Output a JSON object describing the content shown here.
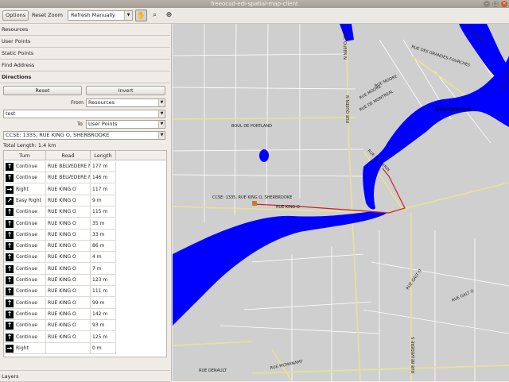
{
  "window": {
    "title": "freeocad-edi-spatial-map-client"
  },
  "toolbar": {
    "options": "Options",
    "reset_zoom": "Reset Zoom",
    "refresh": "Refresh Manually"
  },
  "sidebar": {
    "sections": [
      "Resources",
      "User Points",
      "Static Points",
      "Find Address",
      "Directions"
    ],
    "reset": "Reset",
    "invert": "Invert",
    "from_label": "From",
    "from_value": "Resources",
    "from_point": "test",
    "to_label": "To",
    "to_value": "User Points",
    "to_point": "CCSE: 1335, RUE KING O, SHERBROOKE",
    "total": "Total Length: 1.4 km",
    "layers": "Layers"
  },
  "table": {
    "headers": [
      "Turn",
      "Road",
      "Length"
    ],
    "rows": [
      {
        "icon": "arrow-up",
        "turn": "Continue",
        "road": "RUE BELVEDERE N",
        "len": "177 m"
      },
      {
        "icon": "arrow-up",
        "turn": "Continue",
        "road": "RUE BELVEDERE N",
        "len": "146 m"
      },
      {
        "icon": "arrow-right",
        "turn": "Right",
        "road": "RUE KING O",
        "len": "117 m"
      },
      {
        "icon": "arrow-up-right",
        "turn": "Easy Right",
        "road": "RUE KING O",
        "len": "9 m"
      },
      {
        "icon": "arrow-up",
        "turn": "Continue",
        "road": "RUE KING O",
        "len": "115 m"
      },
      {
        "icon": "arrow-up",
        "turn": "Continue",
        "road": "RUE KING O",
        "len": "35 m"
      },
      {
        "icon": "arrow-up",
        "turn": "Continue",
        "road": "RUE KING O",
        "len": "33 m"
      },
      {
        "icon": "arrow-up",
        "turn": "Continue",
        "road": "RUE KING O",
        "len": "86 m"
      },
      {
        "icon": "arrow-up",
        "turn": "Continue",
        "road": "RUE KING O",
        "len": "4 m"
      },
      {
        "icon": "arrow-up",
        "turn": "Continue",
        "road": "RUE KING O",
        "len": "7 m"
      },
      {
        "icon": "arrow-up",
        "turn": "Continue",
        "road": "RUE KING O",
        "len": "123 m"
      },
      {
        "icon": "arrow-up",
        "turn": "Continue",
        "road": "RUE KING O",
        "len": "111 m"
      },
      {
        "icon": "arrow-up",
        "turn": "Continue",
        "road": "RUE KING O",
        "len": "99 m"
      },
      {
        "icon": "arrow-up",
        "turn": "Continue",
        "road": "RUE KING O",
        "len": "142 m"
      },
      {
        "icon": "arrow-up",
        "turn": "Continue",
        "road": "RUE KING O",
        "len": "93 m"
      },
      {
        "icon": "arrow-up",
        "turn": "Continue",
        "road": "RUE KING O",
        "len": "125 m"
      },
      {
        "icon": "arrow-right",
        "turn": "Right",
        "road": "",
        "len": "0 m"
      }
    ]
  },
  "map": {
    "city": "Sherbrooke",
    "point_label": "CCSE: 1335, RUE KING O, SHERBROOKE",
    "streets": [
      "RUE QUEEN N",
      "RUE DES GRANDES-FOURCHES",
      "RUE MOORE",
      "RUE DE MONTREAL",
      "RUE MOORE",
      "BOUL DE PORTLAND",
      "RUE QUEEN N",
      "RUE DUFFERIN",
      "RUE KING O",
      "RUE GALT O",
      "RUE GALT O",
      "RUE BELVEDERE S",
      "RUE DENAULT",
      "RUE MCMANAMY",
      "RUE TERRILL",
      "RUE WELLINGTON N"
    ],
    "colors": {
      "water": "#0000ff",
      "route": "#cc2222",
      "roads": "#e6e19a",
      "land": "#cfcfcf"
    }
  }
}
